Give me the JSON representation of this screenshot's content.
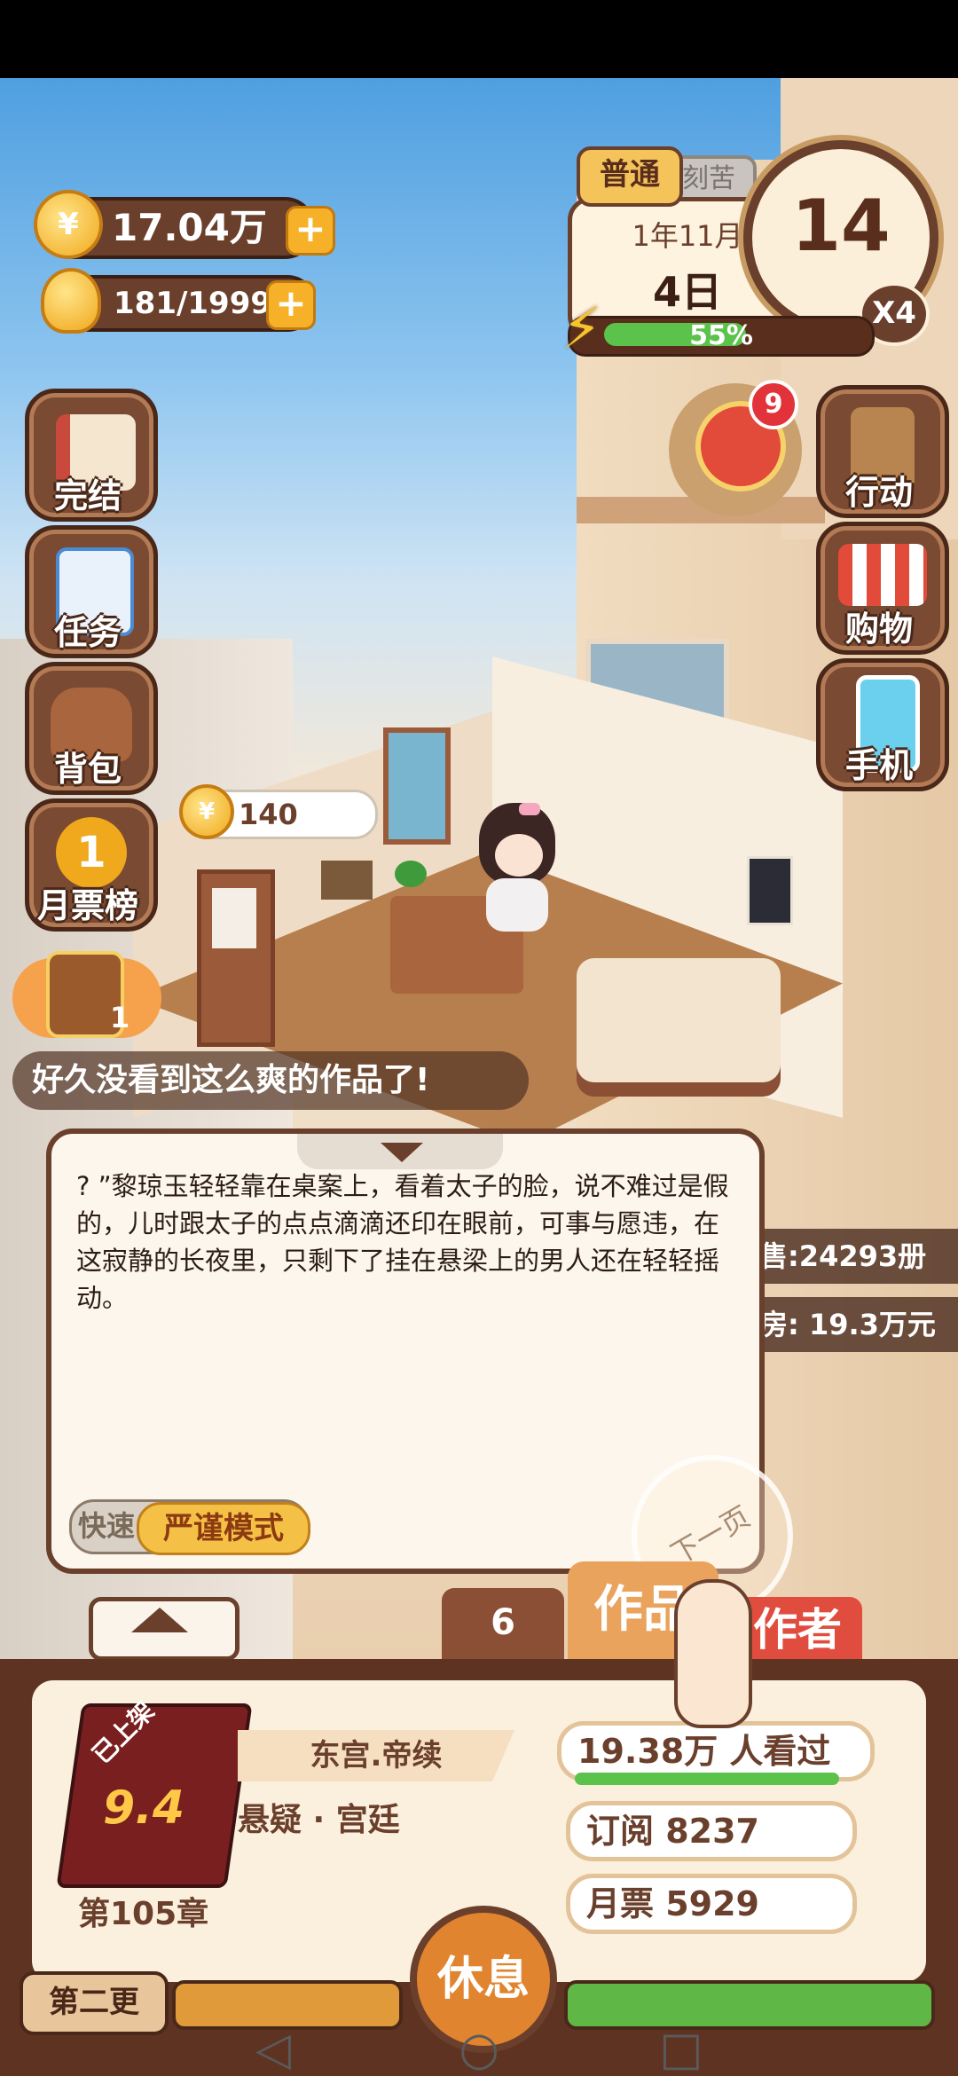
{
  "currency": {
    "coins": "17.04万",
    "energy": "181/1999",
    "coin_icon": "¥"
  },
  "left_menu": [
    {
      "label": "完结",
      "icon": "book-icon",
      "color": "#c94a3c"
    },
    {
      "label": "任务",
      "icon": "checklist-icon",
      "color": "#4a8bd4"
    },
    {
      "label": "背包",
      "icon": "backpack-icon",
      "color": "#a8653e"
    },
    {
      "label": "月票榜",
      "icon": "ticket-coin-icon",
      "color": "#f0a81c"
    }
  ],
  "right_menu": [
    {
      "label": "行动",
      "icon": "door-icon"
    },
    {
      "label": "购物",
      "icon": "shop-icon"
    },
    {
      "label": "手机",
      "icon": "phone-icon"
    }
  ],
  "notice_badge": "9",
  "calendar": {
    "mode": "普通",
    "mode2": "刻苦",
    "month": "1年11月",
    "day": "4日",
    "clock_hour": "14",
    "speed": "X4",
    "energy_percent": 55,
    "energy_label": "55%"
  },
  "coin_bubble": "140",
  "chest_count": "1",
  "comment": "好久没看到这么爽的作品了!",
  "right_stats": {
    "sales": "售:24293册",
    "income": "房: 19.3万元"
  },
  "dialog": {
    "text": "? ”黎琼玉轻轻靠在桌案上，看着太子的脸，说不难过是假的，儿时跟太子的点点滴滴还印在眼前，可事与愿违，在这寂静的长夜里，只剩下了挂在悬梁上的男人还在轻轻摇动。",
    "mode_fast": "快速",
    "mode_strict": "严谨模式",
    "next_page": "下一页"
  },
  "tabs": {
    "count": "6",
    "works": "作品",
    "author": "作者"
  },
  "book": {
    "status": "已上架",
    "score": "9.4",
    "chapter": "第105章",
    "title": "东宫.帝续",
    "genre": "悬疑 · 宫廷"
  },
  "stats": {
    "views": "19.38万 人看过",
    "subscriptions": "订阅 8237",
    "monthly_tickets": "月票 5929"
  },
  "bottom": {
    "rest": "休息",
    "second_update": "第二更"
  },
  "nav": {
    "back": "◁",
    "home": "○",
    "recent": "□"
  }
}
